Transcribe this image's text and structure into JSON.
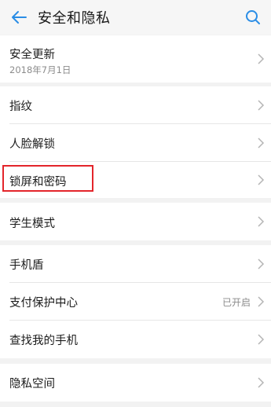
{
  "header": {
    "title": "安全和隐私",
    "back_icon": "arrow-left-icon",
    "search_icon": "search-icon",
    "accent": "#2a8de6"
  },
  "sections": [
    {
      "items": [
        {
          "label": "安全更新",
          "sub": "2018年7月1日"
        }
      ]
    },
    {
      "items": [
        {
          "label": "指纹"
        },
        {
          "label": "人脸解锁"
        },
        {
          "label": "锁屏和密码",
          "highlighted": true
        }
      ]
    },
    {
      "items": [
        {
          "label": "学生模式"
        }
      ]
    },
    {
      "items": [
        {
          "label": "手机盾"
        },
        {
          "label": "支付保护中心",
          "status": "已开启"
        },
        {
          "label": "查找我的手机"
        }
      ]
    },
    {
      "items": [
        {
          "label": "隐私空间"
        }
      ]
    }
  ],
  "highlight_color": "#e3252b"
}
